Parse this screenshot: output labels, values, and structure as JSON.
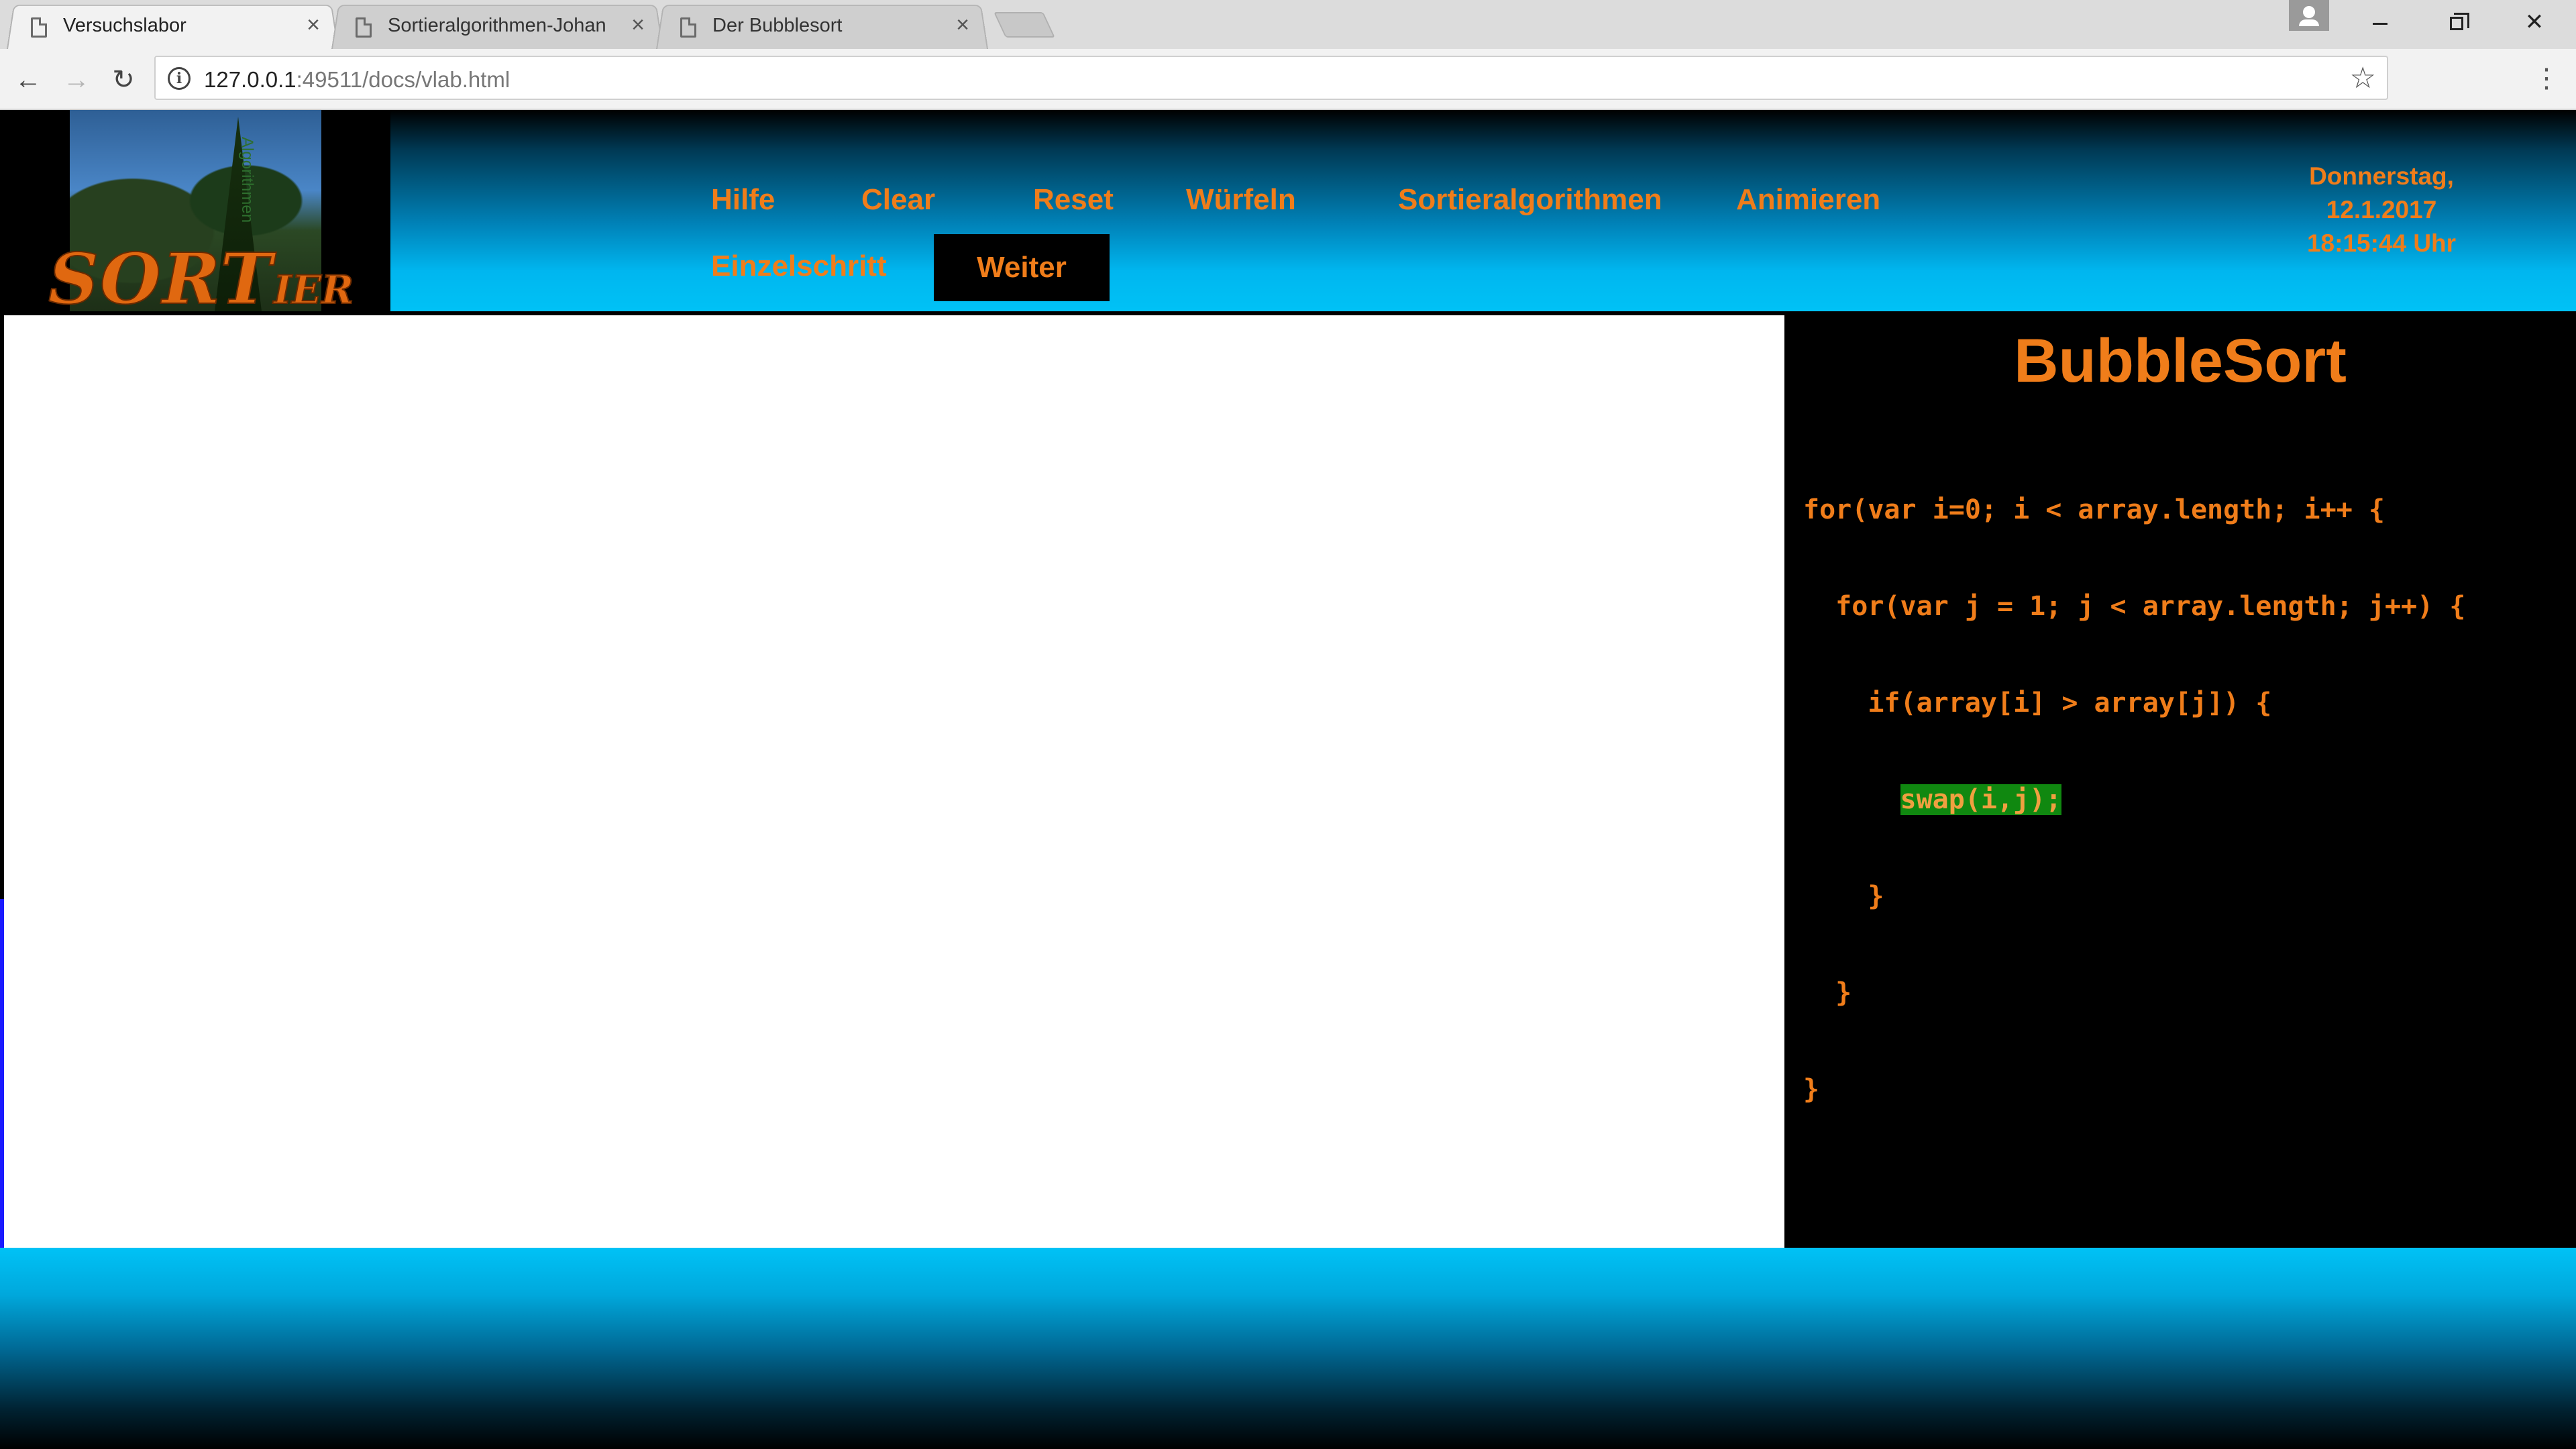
{
  "browser": {
    "tabs": [
      {
        "title": "Versuchslabor",
        "active": true
      },
      {
        "title": "Sortieralgorithmen-Johan",
        "active": false
      },
      {
        "title": "Der Bubblesort",
        "active": false
      }
    ],
    "tab_close_glyph": "×",
    "url_host": "127.0.0.1",
    "url_rest": ":49511/docs/vlab.html",
    "icons": {
      "back": "arrow-left-icon",
      "forward": "arrow-right-icon",
      "reload": "reload-icon",
      "info": "info-icon",
      "star": "star-icon",
      "menu": "kebab-menu-icon",
      "profile": "profile-icon"
    }
  },
  "logo": {
    "tagline": "Algorithmen",
    "word_main": "SORT",
    "word_small": "IER"
  },
  "menu": {
    "hilfe": "Hilfe",
    "clear": "Clear",
    "reset": "Reset",
    "wuerfeln": "Würfeln",
    "algorithms": "Sortieralgorithmen",
    "animate": "Animieren",
    "step": "Einzelschritt",
    "next": "Weiter"
  },
  "datetime": {
    "day": "Donnerstag,",
    "date": "12.1.2017",
    "time": "18:15:44 Uhr"
  },
  "code_panel": {
    "title": "BubbleSort",
    "lines": [
      "for(var i=0; i < array.length; i++ {",
      "  for(var j = 1; j < array.length; j++) {",
      "    if(array[i] > array[j]) {",
      "      swap(i,j);",
      "    }",
      "  }",
      "}"
    ],
    "highlight_line": 3,
    "highlight_text": "swap(i,j);",
    "highlight_color": "#108810"
  },
  "colors": {
    "accent": "#f07d1a",
    "header_cyan": "#00c2f6",
    "canvas": "#ffffff"
  }
}
